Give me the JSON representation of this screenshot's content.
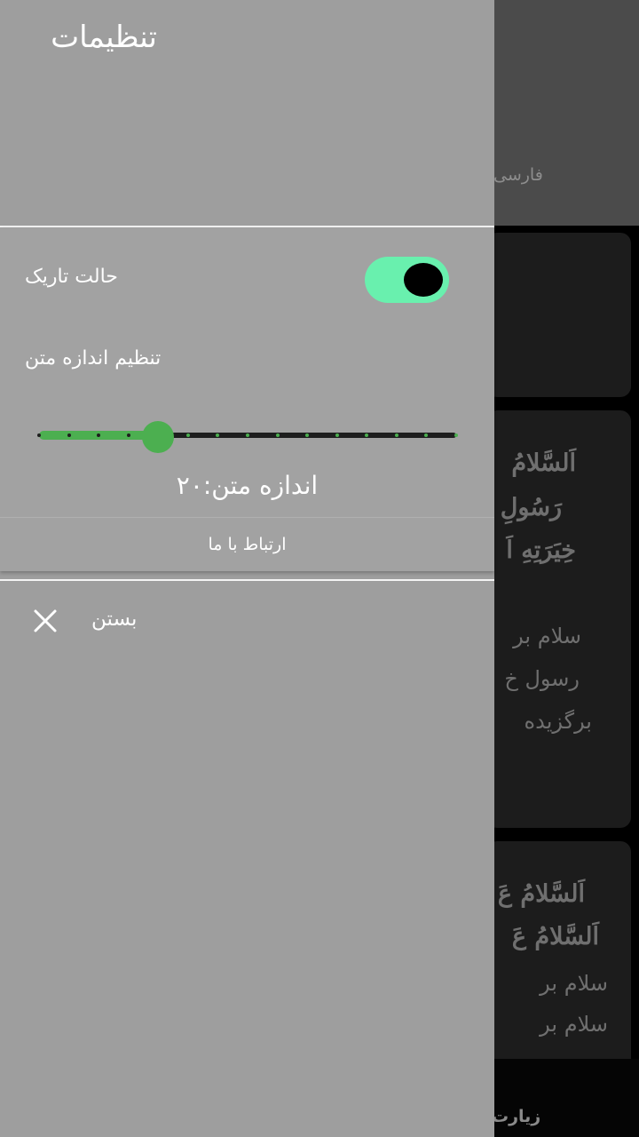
{
  "background": {
    "tab_label": "فارسی",
    "card2_lines": [
      "اَلسَّلامُ",
      "رَسُولِ",
      "خِیَرَتِهِ اَ",
      "سلام بر",
      "رسول خ",
      "برگزیده"
    ],
    "card3_lines": [
      "اَلسَّلامُ عَ",
      "اَلسَّلامُ عَ",
      "سلام بر",
      "سلام بر"
    ],
    "bottom_label": "زیارت"
  },
  "drawer": {
    "title": "تنظیمات",
    "dark_mode": {
      "label": "حالت تاریک",
      "enabled": true
    },
    "text_size": {
      "label": "تنظیم اندازه متن",
      "value_display": "اندازه متن:۲۰",
      "slider": {
        "min": 12,
        "max": 40,
        "step": 2,
        "value": 20
      }
    },
    "contact_label": "ارتباط با ما",
    "close_label": "بستن"
  },
  "colors": {
    "drawer_bg": "#9e9e9e",
    "toggle_track": "#69f0ae",
    "slider_active": "#4caf50",
    "slider_inactive": "#1e1e1e"
  },
  "icons": {
    "close": "close-icon"
  }
}
